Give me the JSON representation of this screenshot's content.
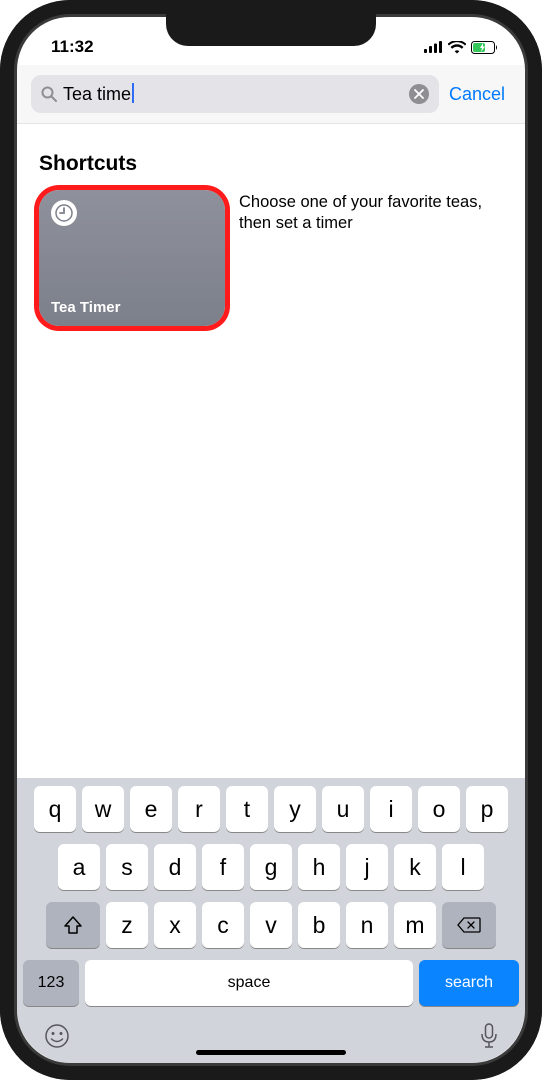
{
  "statusbar": {
    "time": "11:32"
  },
  "search": {
    "value": "Tea time",
    "cancel_label": "Cancel"
  },
  "section": {
    "title": "Shortcuts"
  },
  "result": {
    "card_title": "Tea Timer",
    "description": "Choose one of your favorite teas, then set a timer"
  },
  "keyboard": {
    "row1": [
      "q",
      "w",
      "e",
      "r",
      "t",
      "y",
      "u",
      "i",
      "o",
      "p"
    ],
    "row2": [
      "a",
      "s",
      "d",
      "f",
      "g",
      "h",
      "j",
      "k",
      "l"
    ],
    "row3": [
      "z",
      "x",
      "c",
      "v",
      "b",
      "n",
      "m"
    ],
    "num_label": "123",
    "space_label": "space",
    "search_label": "search"
  }
}
